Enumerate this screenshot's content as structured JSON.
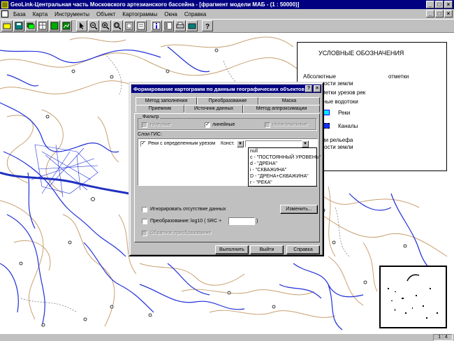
{
  "window": {
    "title": "GeoLink-Центральная часть Московского артезианского бассейна - [фрагмент модели МАБ - (1 : 50000)]",
    "controls": [
      "_",
      "□",
      "×"
    ]
  },
  "menu": [
    "База",
    "Карта",
    "Инструменты",
    "Объект",
    "Картограммы",
    "Окна",
    "Справка"
  ],
  "toolbar_icons": [
    "open-icon",
    "save-icon",
    "layers-icon",
    "table-icon",
    "grid-icon",
    "chart-icon",
    "pointer-icon",
    "zoom-out-icon",
    "zoom-in-icon",
    "zoom-window-icon",
    "full-extent-icon",
    "refresh-icon",
    "info-icon",
    "properties-icon",
    "print-icon",
    "print-preview-icon",
    "help-icon"
  ],
  "legend": {
    "title": "УСЛОВНЫЕ ОБОЗНАЧЕНИЯ",
    "item1_line1": "Абсолютные",
    "item1_line1b": "отметки",
    "item1_line2": "поверхности земли",
    "item2": "Абс. отметки урезов рек",
    "item3": "Временные водотоки",
    "rivers": "Реки",
    "canals": "Каналы",
    "isolines_line1": "Изолинии рельефа",
    "isolines_line2": "поверхности земли",
    "colors": {
      "rivers": "#00ffff",
      "canals": "#0000ff",
      "isolines": "#c8a070"
    }
  },
  "dialog": {
    "title": "Формирование картограмм по данным географических объектов",
    "help_btn": "?",
    "close_btn": "×",
    "tabs_row1": [
      "Метод заполнения",
      "Преобразование",
      "Маска"
    ],
    "tabs_row2": [
      "Приемник",
      "Источник данных",
      "Метод аппроксимации"
    ],
    "active_tab": "Источник данных",
    "filter_label": "Фильтр",
    "filter_point": "точечные",
    "filter_line": "линейные",
    "filter_polygon": "полигональные",
    "layers_label": "Слои ГИС:",
    "layer_row": "Реки с определенным урезом",
    "const_value": "Конст.",
    "dropdown_options": [
      "null",
      "c - \"ПОСТОЯННЫЙ УРОВЕНЬ\"",
      "d - \"ДРЕНА\"",
      "i - \"СКВАЖИНА\"",
      "D - \"ДРЕНА+СКВАЖИНА\"",
      "r - \"РЕКА\""
    ],
    "ignore_missing": "Игнорировать отсутствие данных",
    "change_button": "Изменить...",
    "transform_label": "Преобразование:",
    "transform_formula": "log10 ( SRC +",
    "transform_close": ")",
    "inverse_transform": "Обратное преобразование",
    "btn_ok": "Выполнить",
    "btn_exit": "Выйти",
    "btn_help": "Справка"
  },
  "status": {
    "scale": "1 : 4"
  }
}
